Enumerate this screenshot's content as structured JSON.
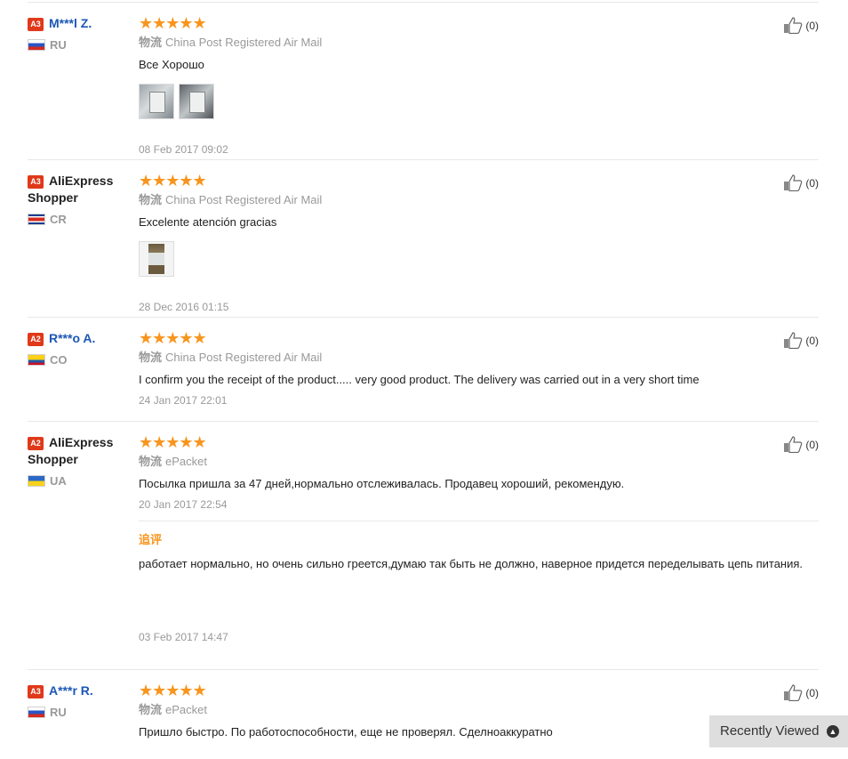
{
  "reviews": [
    {
      "level": "A3",
      "name": "M***l Z.",
      "country": "RU",
      "flag": "ru",
      "stars": "★★★★★",
      "logistics_label": "物流",
      "logistics": "China Post Registered Air Mail",
      "text": "Все Хорошо",
      "date": "08 Feb 2017 09:02",
      "likes": "(0)"
    },
    {
      "level": "A3",
      "name_line1": "AliExpress",
      "name_line2": "Shopper",
      "country": "CR",
      "flag": "cr",
      "stars": "★★★★★",
      "logistics_label": "物流",
      "logistics": "China Post Registered Air Mail",
      "text": "Excelente atención gracias",
      "date": "28 Dec 2016 01:15",
      "likes": "(0)"
    },
    {
      "level": "A2",
      "name": "R***o A.",
      "country": "CO",
      "flag": "co",
      "stars": "★★★★★",
      "logistics_label": "物流",
      "logistics": "China Post Registered Air Mail",
      "text": "I confirm you the receipt of the product..... very good product. The delivery was carried out in a very short time",
      "date": "24 Jan 2017 22:01",
      "likes": "(0)"
    },
    {
      "level": "A2",
      "name_line1": "AliExpress",
      "name_line2": "Shopper",
      "country": "UA",
      "flag": "ua",
      "stars": "★★★★★",
      "logistics_label": "物流",
      "logistics": "ePacket",
      "text": "Посылка пришла за 47 дней,нормально отслеживалась. Продавец хороший, рекомендую.",
      "date": "20 Jan 2017 22:54",
      "likes": "(0)",
      "append_label": "追评",
      "append_text": "работает нормально, но очень сильно греется,думаю так быть не должно, наверное придется переделывать цепь питания.",
      "append_date": "03 Feb 2017 14:47"
    },
    {
      "level": "A3",
      "name": "A***r R.",
      "country": "RU",
      "flag": "ru",
      "stars": "★★★★★",
      "logistics_label": "物流",
      "logistics": "ePacket",
      "text": "Пришло быстро. По работоспособности, еще не проверял. Сделноаккуратно",
      "likes": "(0)"
    }
  ],
  "recently_viewed": {
    "label": "Recently Viewed",
    "icon": "chevron-up-icon"
  }
}
